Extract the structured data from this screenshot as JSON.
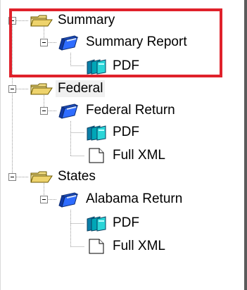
{
  "tree": {
    "nodes": [
      {
        "id": "summary",
        "label": "Summary",
        "icon": "folder-open-icon",
        "expanded": true
      },
      {
        "id": "summary-report",
        "label": "Summary Report",
        "icon": "book-icon",
        "expanded": true
      },
      {
        "id": "summary-pdf",
        "label": "PDF",
        "icon": "pages-icon"
      },
      {
        "id": "federal",
        "label": "Federal",
        "icon": "folder-open-icon",
        "expanded": true
      },
      {
        "id": "federal-return",
        "label": "Federal Return",
        "icon": "book-icon",
        "expanded": true
      },
      {
        "id": "federal-pdf",
        "label": "PDF",
        "icon": "pages-icon"
      },
      {
        "id": "federal-xml",
        "label": "Full XML",
        "icon": "document-icon"
      },
      {
        "id": "states",
        "label": "States",
        "icon": "folder-open-icon",
        "expanded": true
      },
      {
        "id": "alabama-return",
        "label": "Alabama Return",
        "icon": "book-icon",
        "expanded": true
      },
      {
        "id": "alabama-pdf",
        "label": "PDF",
        "icon": "pages-icon"
      },
      {
        "id": "alabama-xml",
        "label": "Full XML",
        "icon": "document-icon"
      }
    ]
  },
  "highlight": {
    "color": "#e0212b"
  },
  "colors": {
    "folder": "#f3df87",
    "book_blue": "#1f4fbf",
    "pages_teal": "#00a6b7"
  }
}
